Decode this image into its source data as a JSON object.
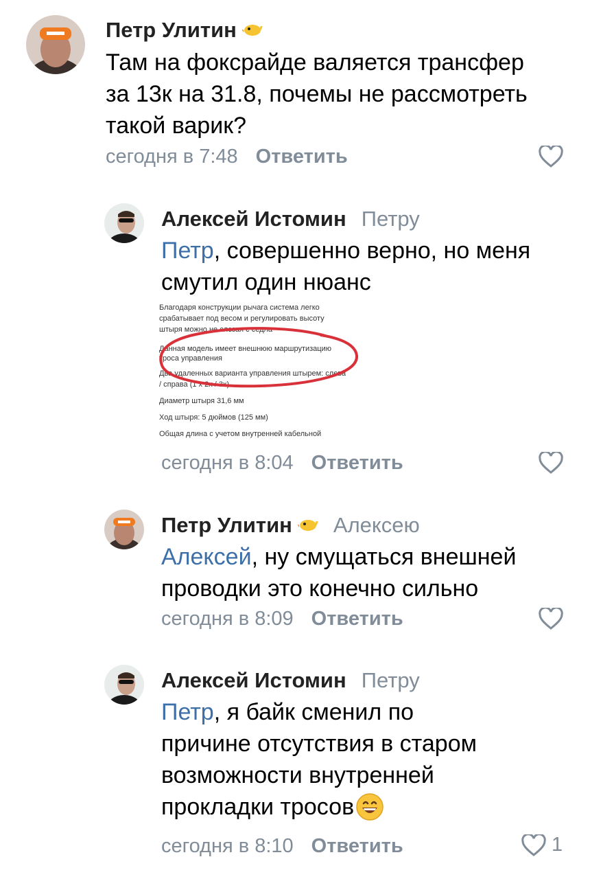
{
  "comments": [
    {
      "author": "Петр Улитин",
      "text_lines": [
        "Там на фоксрайде валяется трансфер",
        "за 13к на 31.8, почемы не рассмотреть",
        "такой варик?"
      ],
      "time": "сегодня в 7:48",
      "reply_label": "Ответить"
    },
    {
      "author": "Алексей Истомин",
      "reply_to": "Петру",
      "mention": "Петр",
      "text_lines": [
        ", совершенно верно, но меня",
        "смутил один нюанс"
      ],
      "attachment": {
        "lines": [
          "Благодаря конструкции рычага система легко",
          "срабатывает под весом и регулировать высоту",
          "штыря можно не слезая с седла",
          "Данная модель имеет внешнюю маршрутизацию",
          "троса управления",
          "Два удаленных варианта управления штырем: слева",
          "/ справа (1 x 2x / 3x)",
          "Диаметр штыря 31,6 мм",
          "Ход штыря: 5 дюймов (125 мм)",
          "Общая длина с учетом внутренней кабельной"
        ]
      },
      "time": "сегодня в 8:04",
      "reply_label": "Ответить"
    },
    {
      "author": "Петр Улитин",
      "reply_to": "Алексею",
      "mention": "Алексей",
      "text_lines": [
        ", ну смущаться внешней",
        "проводки это конечно сильно"
      ],
      "time": "сегодня в 8:09",
      "reply_label": "Ответить"
    },
    {
      "author": "Алексей Истомин",
      "reply_to": "Петру",
      "mention": "Петр",
      "text_lines": [
        ", я байк сменил по",
        "причине отсутствия в старом",
        "возможности внутренней",
        "прокладки тросов"
      ],
      "time": "сегодня в 8:10",
      "reply_label": "Ответить",
      "likes": "1"
    }
  ],
  "icons": {
    "like": "heart-outline-icon",
    "badge": "duck-icon",
    "emoji": "grinning-face-icon"
  },
  "colors": {
    "mention": "#3d6fa8",
    "meta": "#818c99",
    "circle": "#d9313a"
  }
}
